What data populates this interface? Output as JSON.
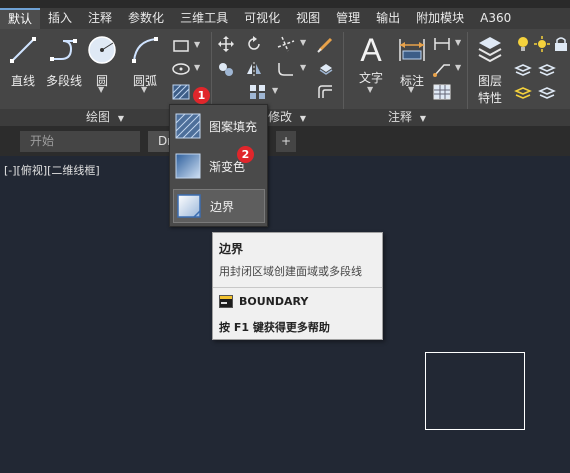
{
  "ribbon_tabs": [
    "默认",
    "插入",
    "注释",
    "参数化",
    "三维工具",
    "可视化",
    "视图",
    "管理",
    "输出",
    "附加模块",
    "A360"
  ],
  "active_tab_index": 0,
  "draw_panel": {
    "title": "绘图",
    "line_label": "直线",
    "polyline_label": "多段线",
    "circle_label": "圆",
    "arc_label": "圆弧"
  },
  "modify_panel": {
    "title_partial": "修改"
  },
  "annotation_panel": {
    "title": "注释",
    "text_label": "文字",
    "dimension_label": "标注"
  },
  "layers_panel": {
    "label_line1": "图层",
    "label_line2": "特性"
  },
  "flyout": {
    "items": [
      {
        "label": "图案填充",
        "icon": "hatch-icon"
      },
      {
        "label": "渐变色",
        "icon": "gradient-icon"
      },
      {
        "label": "边界",
        "icon": "boundary-icon"
      }
    ],
    "highlighted_index": 2
  },
  "badges": {
    "first": "1",
    "second": "2"
  },
  "document_tabs": [
    {
      "label": "开始"
    },
    {
      "label": "Dr"
    }
  ],
  "viewport_label": "[-][俯视][二维线框]",
  "tooltip": {
    "title": "边界",
    "description": "用封闭区域创建面域或多段线",
    "command": "BOUNDARY",
    "help_text": "按 F1 键获得更多帮助"
  },
  "colors": {
    "badge_red": "#e0262b",
    "canvas_bg": "#222834",
    "ribbon_bg": "#464646",
    "accent_blue": "#6fa2d6"
  }
}
